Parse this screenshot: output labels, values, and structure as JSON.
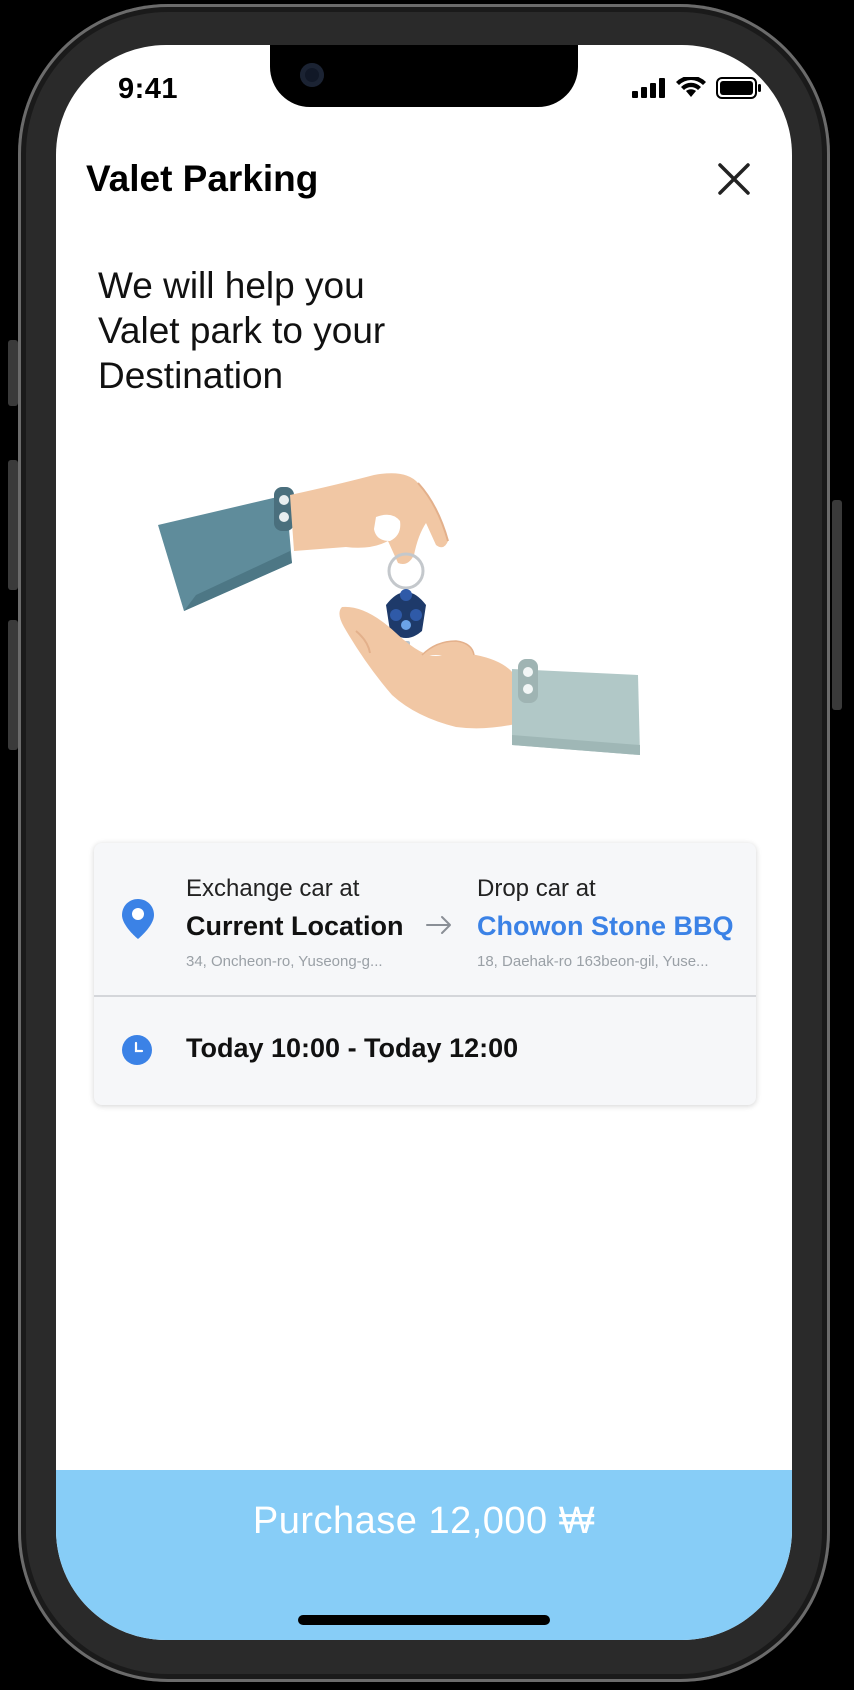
{
  "status_bar": {
    "time": "9:41"
  },
  "header": {
    "title": "Valet Parking",
    "close_icon": "close-icon"
  },
  "headline": {
    "line1": "We will help you",
    "line2": "Valet park to your",
    "line3": "Destination"
  },
  "trip": {
    "exchange_label": "Exchange car at",
    "exchange_place": "Current Location",
    "exchange_address": "34, Oncheon-ro, Yuseong-g...",
    "drop_label": "Drop car at",
    "drop_place": "Chowon Stone BBQ",
    "drop_address": "18, Daehak-ro 163beon-gil, Yuse...",
    "time_range": "Today 10:00 - Today 12:00"
  },
  "purchase": {
    "label": "Purchase 12,000 ₩"
  },
  "colors": {
    "accent": "#3b82e6",
    "purchase_bg": "#87cdf7",
    "card_bg": "#f6f7f9"
  }
}
